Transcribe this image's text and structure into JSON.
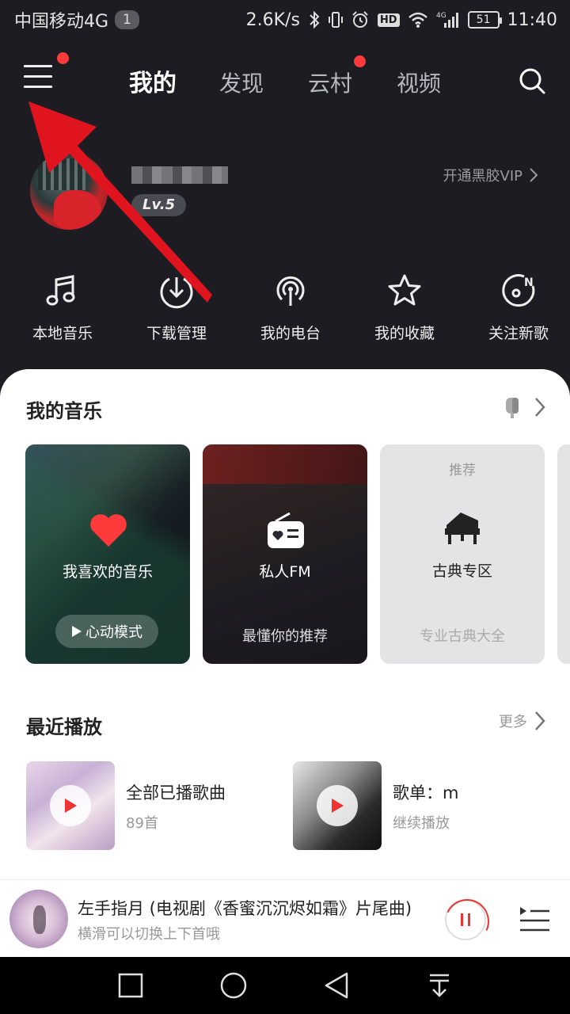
{
  "status_bar": {
    "carrier": "中国移动4G",
    "sim": "1",
    "speed": "2.6K/s",
    "hd": "HD",
    "signal_type": "4G",
    "battery": "51",
    "time": "11:40"
  },
  "nav": {
    "tabs": [
      {
        "label": "我的",
        "active": true
      },
      {
        "label": "发现",
        "active": false
      },
      {
        "label": "云村",
        "active": false,
        "dot": true
      },
      {
        "label": "视频",
        "active": false
      }
    ],
    "menu_icon": "hamburger-icon",
    "search_icon": "search-icon"
  },
  "profile": {
    "level": "Lv.5",
    "vip_link": "开通黑胶VIP"
  },
  "quick_actions": [
    {
      "label": "本地音乐",
      "icon": "music-note-icon"
    },
    {
      "label": "下载管理",
      "icon": "download-icon"
    },
    {
      "label": "我的电台",
      "icon": "podcast-icon"
    },
    {
      "label": "我的收藏",
      "icon": "star-icon"
    },
    {
      "label": "关注新歌",
      "icon": "new-song-icon"
    }
  ],
  "my_music": {
    "title": "我的音乐",
    "cards": {
      "liked": {
        "title": "我喜欢的音乐",
        "button": "心动模式"
      },
      "fm": {
        "title": "私人FM",
        "subtitle": "最懂你的推荐"
      },
      "classic": {
        "tag": "推荐",
        "title": "古典专区",
        "subtitle": "专业古典大全"
      }
    }
  },
  "recent": {
    "title": "最近播放",
    "more": "更多",
    "items": [
      {
        "title": "全部已播歌曲",
        "subtitle": "89首"
      },
      {
        "title": "歌单：m",
        "subtitle": "继续播放"
      }
    ]
  },
  "player": {
    "title": "左手指月 (电视剧《香蜜沉沉烬如霜》片尾曲)",
    "subtitle": "横滑可以切换上下首哦"
  },
  "colors": {
    "accent": "#ff3a3a",
    "background_dark": "#1c1c22",
    "sheet": "#ffffff"
  }
}
